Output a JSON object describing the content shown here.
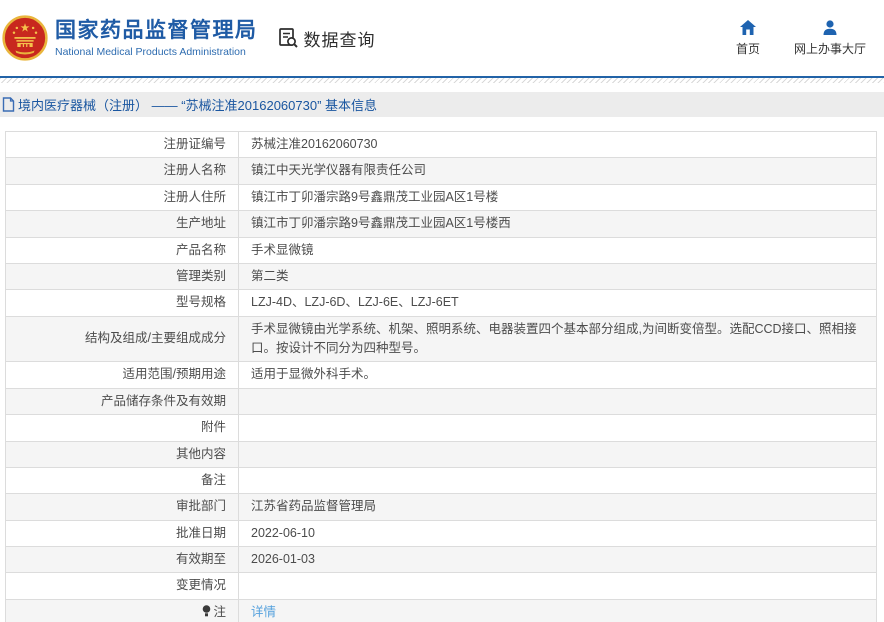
{
  "header": {
    "agency_title": "国家药品监督管理局",
    "agency_subtitle": "National Medical Products Administration",
    "data_query": "数据查询",
    "nav": [
      {
        "label": "首页",
        "icon": "home-icon"
      },
      {
        "label": "网上办事大厅",
        "icon": "user-icon"
      }
    ]
  },
  "breadcrumb": "境内医疗器械（注册） —— “苏械注准20162060730” 基本信息",
  "table": {
    "rows": [
      {
        "label": "注册证编号",
        "value": "苏械注准20162060730"
      },
      {
        "label": "注册人名称",
        "value": "镇江中天光学仪器有限责任公司"
      },
      {
        "label": "注册人住所",
        "value": "镇江市丁卯潘宗路9号鑫鼎茂工业园A区1号楼"
      },
      {
        "label": "生产地址",
        "value": "镇江市丁卯潘宗路9号鑫鼎茂工业园A区1号楼西"
      },
      {
        "label": "产品名称",
        "value": "手术显微镜"
      },
      {
        "label": "管理类别",
        "value": "第二类"
      },
      {
        "label": "型号规格",
        "value": "LZJ-4D、LZJ-6D、LZJ-6E、LZJ-6ET"
      },
      {
        "label": "结构及组成/主要组成成分",
        "value": "手术显微镜由光学系统、机架、照明系统、电器装置四个基本部分组成,为间断变倍型。选配CCD接口、照相接口。按设计不同分为四种型号。"
      },
      {
        "label": "适用范围/预期用途",
        "value": "适用于显微外科手术。"
      },
      {
        "label": "产品储存条件及有效期",
        "value": ""
      },
      {
        "label": "附件",
        "value": ""
      },
      {
        "label": "其他内容",
        "value": ""
      },
      {
        "label": "备注",
        "value": ""
      },
      {
        "label": "审批部门",
        "value": "江苏省药品监督管理局"
      },
      {
        "label": "批准日期",
        "value": "2022-06-10"
      },
      {
        "label": "有效期至",
        "value": "2026-01-03"
      },
      {
        "label": "变更情况",
        "value": ""
      },
      {
        "label": "注",
        "label_icon": "bulb-icon",
        "value": "详情",
        "link": true
      }
    ]
  },
  "colors": {
    "brand_blue": "#1f5ba5",
    "nav_icon_blue": "#1e63b0",
    "breadcrumb_blue": "#1a56a0",
    "link_blue": "#55a1dd",
    "header_rule_blue": "#2263a7",
    "row_alt_bg": "#f5f5f5",
    "table_border": "#dcdcdc",
    "emblem_red": "#c8281e",
    "emblem_gold": "#f0c04a"
  }
}
